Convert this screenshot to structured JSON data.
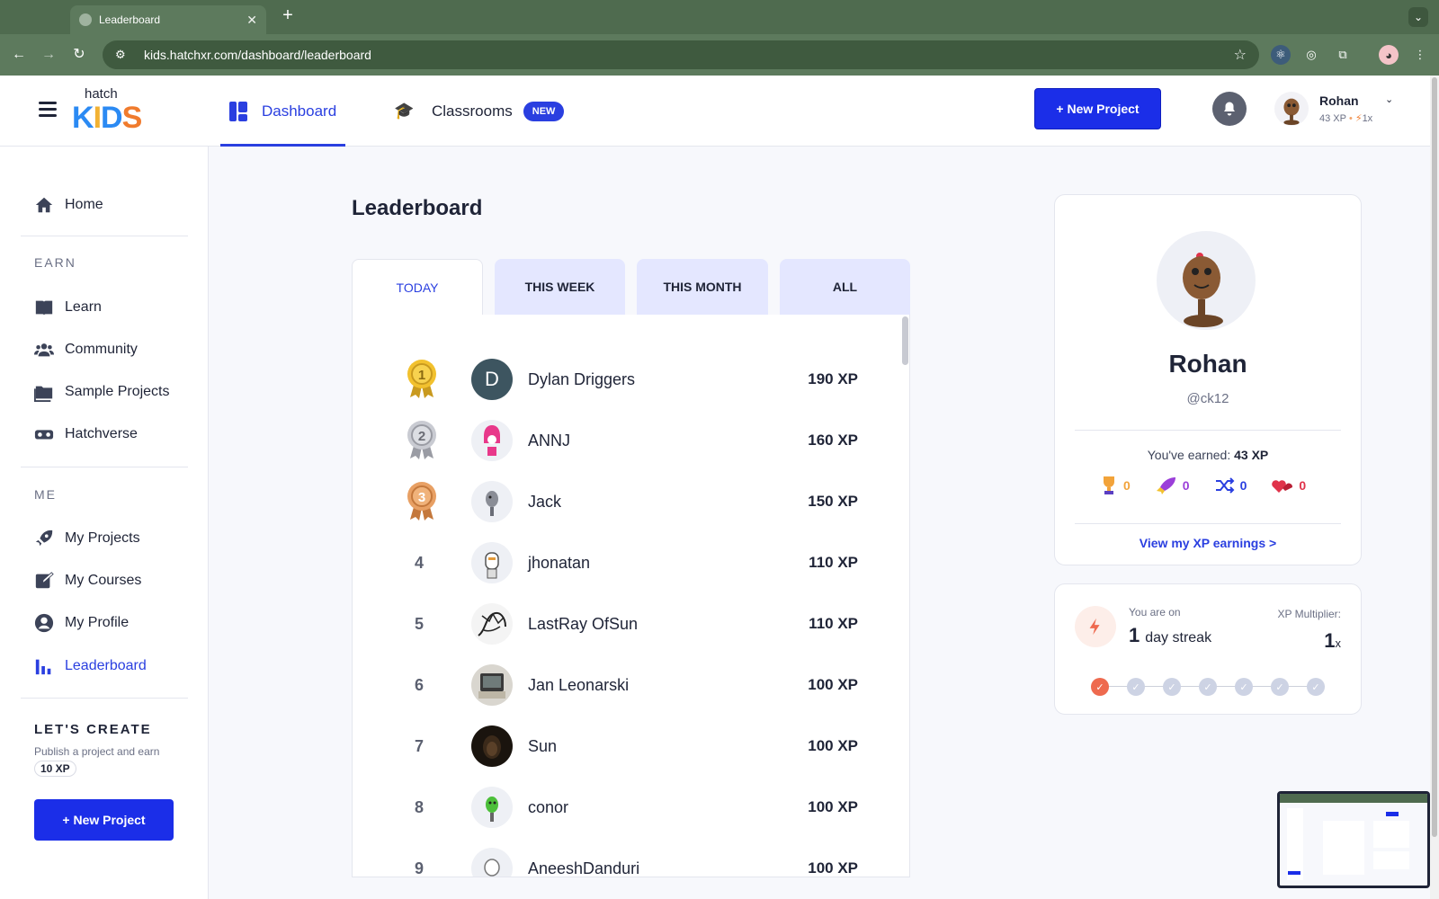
{
  "browser": {
    "tab_title": "Leaderboard",
    "url": "kids.hatchxr.com/dashboard/leaderboard"
  },
  "header": {
    "logo_small": "hatch",
    "logo_big": [
      "K",
      "I",
      "D",
      "S",
      ""
    ],
    "nav": [
      {
        "label": "Dashboard",
        "active": true
      },
      {
        "label": "Classrooms",
        "badge": "NEW"
      }
    ],
    "new_project": "+ New Project",
    "user": {
      "name": "Rohan",
      "xp": "43 XP",
      "multiplier": "1x"
    }
  },
  "sidebar": {
    "home": "Home",
    "earn_section": "EARN",
    "earn_items": [
      "Learn",
      "Community",
      "Sample Projects",
      "Hatchverse"
    ],
    "me_section": "ME",
    "me_items": [
      "My Projects",
      "My Courses",
      "My Profile",
      "Leaderboard"
    ],
    "lets_create": "LET'S CREATE",
    "lets_create_sub": "Publish a project and earn",
    "lets_create_xp": "10 XP",
    "new_project": "+ New Project"
  },
  "main": {
    "title": "Leaderboard",
    "tabs": [
      "TODAY",
      "THIS WEEK",
      "THIS MONTH",
      "ALL"
    ],
    "active_tab": "TODAY",
    "rows": [
      {
        "rank": "1",
        "name": "Dylan Driggers",
        "xp": "190 XP",
        "medal": "gold",
        "initial": "D"
      },
      {
        "rank": "2",
        "name": "ANNJ",
        "xp": "160 XP",
        "medal": "silver"
      },
      {
        "rank": "3",
        "name": "Jack",
        "xp": "150 XP",
        "medal": "bronze"
      },
      {
        "rank": "4",
        "name": "jhonatan",
        "xp": "110 XP"
      },
      {
        "rank": "5",
        "name": "LastRay OfSun",
        "xp": "110 XP"
      },
      {
        "rank": "6",
        "name": "Jan Leonarski",
        "xp": "100 XP"
      },
      {
        "rank": "7",
        "name": "Sun",
        "xp": "100 XP"
      },
      {
        "rank": "8",
        "name": "conor",
        "xp": "100 XP"
      },
      {
        "rank": "9",
        "name": "AneeshDanduri",
        "xp": "100 XP"
      }
    ]
  },
  "profile": {
    "name": "Rohan",
    "handle": "@ck12",
    "earned_label": "You've earned:",
    "earned_xp": "43 XP",
    "badges": [
      {
        "icon": "trophy-icon",
        "count": "0",
        "color": "#f2a33a"
      },
      {
        "icon": "rocket-icon",
        "count": "0",
        "color": "#9b3fd9"
      },
      {
        "icon": "shuffle-icon",
        "count": "0",
        "color": "#2a3fe0"
      },
      {
        "icon": "hearts-icon",
        "count": "0",
        "color": "#e0334a"
      }
    ],
    "view_earnings": "View my XP earnings >"
  },
  "streak": {
    "you_are_on": "You are on",
    "days": "1",
    "unit": "day streak",
    "multiplier_label": "XP Multiplier:",
    "multiplier_value": "1",
    "multiplier_suffix": "x",
    "days_done": 1,
    "days_total": 7
  },
  "colors": {
    "accent": "#2a3fe0",
    "button": "#1b2ee8",
    "streak": "#ee6a4f"
  }
}
